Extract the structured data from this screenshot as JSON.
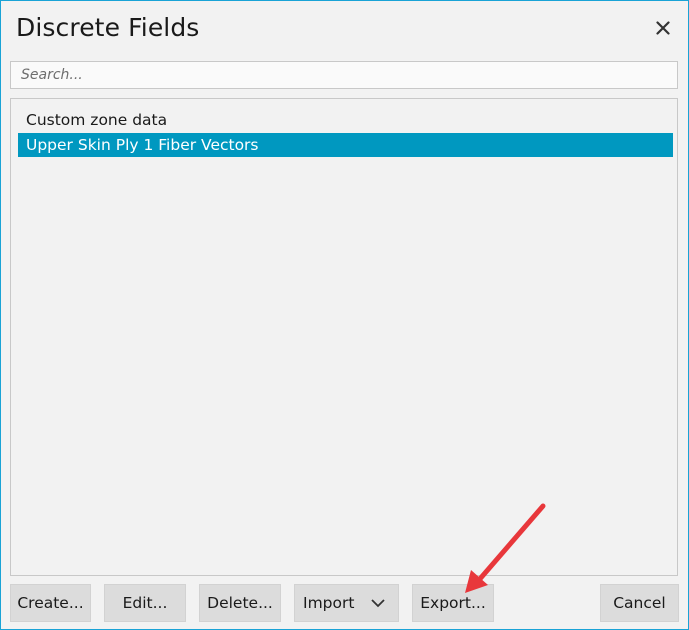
{
  "dialog": {
    "title": "Discrete Fields",
    "close_icon": "close-icon"
  },
  "search": {
    "placeholder": "Search...",
    "value": ""
  },
  "list": {
    "items": [
      {
        "label": "Custom zone data",
        "selected": false
      },
      {
        "label": "Upper Skin Ply 1 Fiber Vectors",
        "selected": true
      }
    ]
  },
  "buttons": {
    "create": "Create...",
    "edit": "Edit...",
    "delete": "Delete...",
    "import": "Import",
    "import_icon": "chevron-down-icon",
    "export": "Export...",
    "cancel": "Cancel"
  },
  "annotation": {
    "icon": "red-arrow-icon",
    "color": "#e8373b"
  },
  "colors": {
    "accent_border": "#19a3d6",
    "selection": "#0098c0",
    "button_bg": "#dcdcdc",
    "dialog_bg": "#f2f2f2"
  }
}
